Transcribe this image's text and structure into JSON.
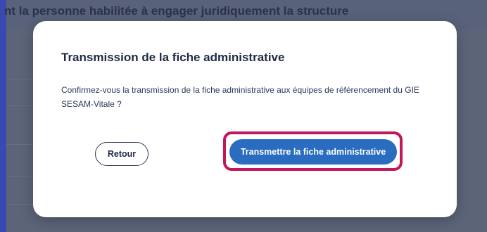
{
  "background": {
    "heading": "nt la personne habilitée à engager juridiquement la structure"
  },
  "modal": {
    "title": "Transmission de la fiche administrative",
    "body": "Confirmez-vous la transmission de la fiche administrative aux équipes de référencement du GIE SESAM-Vitale ?",
    "back_label": "Retour",
    "confirm_label": "Transmettre la fiche administrative"
  },
  "colors": {
    "primary": "#2a6cbf",
    "highlight": "#c4165a"
  }
}
